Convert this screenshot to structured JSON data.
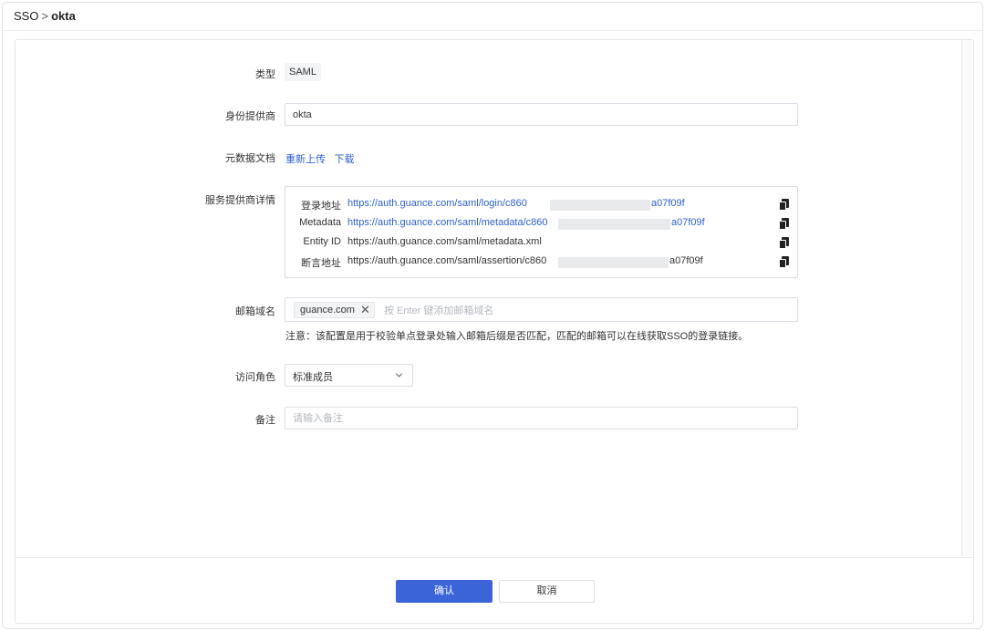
{
  "breadcrumb": {
    "parent": "SSO",
    "separator": ">",
    "current": "okta"
  },
  "form": {
    "type": {
      "label": "类型",
      "value": "SAML"
    },
    "provider": {
      "label": "身份提供商",
      "value": "okta"
    },
    "metadata": {
      "label": "元数据文档",
      "reupload": "重新上传",
      "download": "下载"
    },
    "sp_details": {
      "label": "服务提供商详情",
      "rows": [
        {
          "key": "登录地址",
          "prefix": "https://auth.guance.com/saml/login/c860",
          "suffix": "a07f09f",
          "masked": true,
          "link": true
        },
        {
          "key": "Metadata",
          "prefix": "https://auth.guance.com/saml/metadata/c860",
          "suffix": "a07f09f",
          "masked": true,
          "link": true
        },
        {
          "key": "Entity ID",
          "prefix": "https://auth.guance.com/saml/metadata.xml",
          "suffix": "",
          "masked": false,
          "link": false
        },
        {
          "key": "断言地址",
          "prefix": "https://auth.guance.com/saml/assertion/c860",
          "suffix": "a07f09f",
          "masked": true,
          "link": false
        }
      ],
      "copy_icon": "copy-icon"
    },
    "email_domain": {
      "label": "邮箱域名",
      "tag": "guance.com",
      "placeholder": "按 Enter 键添加邮箱域名",
      "note": "注意：该配置是用于校验单点登录处输入邮箱后缀是否匹配，匹配的邮箱可以在线获取SSO的登录链接。"
    },
    "role": {
      "label": "访问角色",
      "value": "标准成员"
    },
    "remark": {
      "label": "备注",
      "placeholder": "请输入备注"
    }
  },
  "actions": {
    "confirm": "确认",
    "cancel": "取消"
  },
  "colors": {
    "primary": "#3b64d8",
    "link": "#2f61d3",
    "border": "#dcdfe6"
  }
}
